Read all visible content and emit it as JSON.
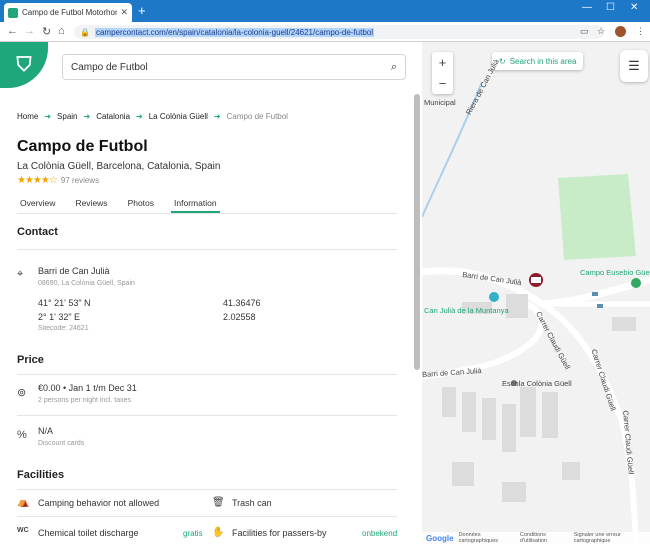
{
  "browser": {
    "tab_title": "Campo de Futbol Motorhome st",
    "url": "campercontact.com/en/spain/catalonia/la-colonia-guell/24621/campo-de-futbol"
  },
  "search": {
    "value": "Campo de Futbol"
  },
  "breadcrumb": [
    "Home",
    "Spain",
    "Catalonia",
    "La Colònia Güell",
    "Campo de Futbol"
  ],
  "place": {
    "title": "Campo de Futbol",
    "location": "La Colònia Güell, Barcelona, Catalonia, Spain",
    "rating": 3.5,
    "stars": "★★★★☆",
    "reviews": "97 reviews"
  },
  "tabs": [
    "Overview",
    "Reviews",
    "Photos",
    "Information"
  ],
  "contact": {
    "heading": "Contact",
    "address": "Barri de Can Julià",
    "postal": "08690, La Colònia Güell, Spain",
    "lat_dms": "41° 21' 53\" N",
    "lon_dms": "2° 1' 32\" E",
    "lat_dec": "41.36476",
    "lon_dec": "2.02558",
    "sitecode": "Sitecode: 24621"
  },
  "price": {
    "heading": "Price",
    "price": "€0.00 • Jan 1 t/m Dec 31",
    "price_note": "2 persons per night incl. taxes",
    "discount": "N/A",
    "discount_note": "Discount cards"
  },
  "facilities": {
    "heading": "Facilities",
    "items": [
      {
        "label": "Camping behavior not allowed",
        "tag": "",
        "icon": "tent-icon"
      },
      {
        "label": "Trash can",
        "tag": "",
        "icon": "trash-icon"
      },
      {
        "label": "Chemical toilet discharge",
        "tag": "gratis",
        "icon": "wc-icon"
      },
      {
        "label": "Facilities for passers-by",
        "tag": "onbekend",
        "icon": "hands-icon"
      }
    ]
  },
  "map": {
    "search_area": "Search in this area",
    "labels": {
      "municipal": "Municipal",
      "riera": "Riera de Can Julià",
      "barri1": "Barri de Can Julià",
      "barri2": "Barri de Can Julià",
      "campo": "Campo Eusebio Güell",
      "muntanya": "Can Julià de la Muntanya",
      "claudi1": "Carrer Claudi Güell",
      "claudi2": "Carrer Claudi Güell",
      "claudi3": "Carrer Claudi Güell",
      "escola": "Escola Colònia Güell"
    },
    "footer": [
      "Google",
      "Données cartographiques",
      "Conditions d'utilisation",
      "Signaler une erreur cartographique"
    ]
  },
  "colors": {
    "accent": "#1fa67a",
    "chrome": "#1e78c8"
  }
}
